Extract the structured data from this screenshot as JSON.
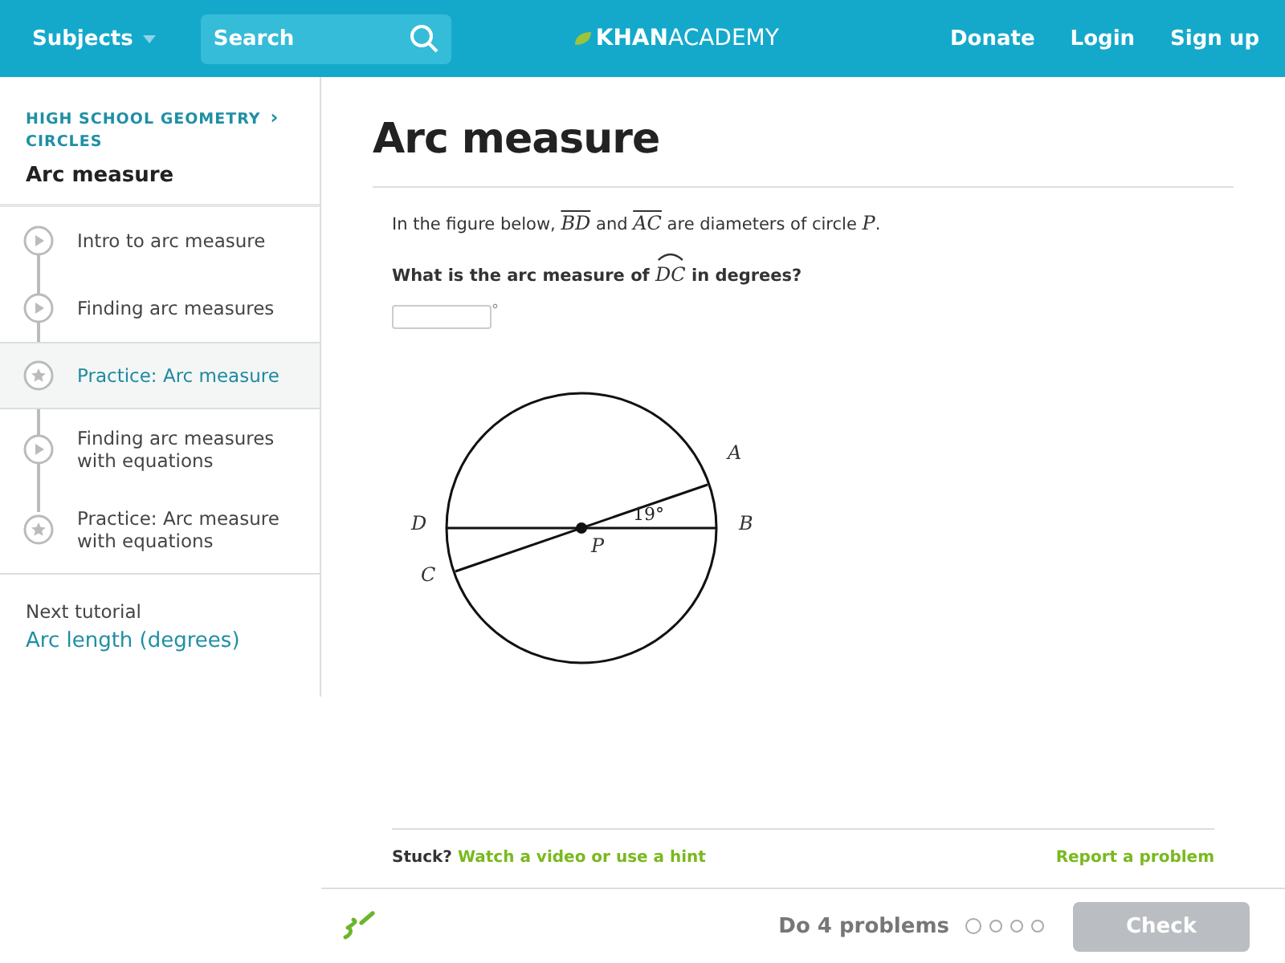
{
  "header": {
    "subjects": "Subjects",
    "search": {
      "placeholder": "Search"
    },
    "logo": {
      "bold": "KHAN",
      "light": "ACADEMY"
    },
    "links": [
      "Donate",
      "Login",
      "Sign up"
    ]
  },
  "sidebar": {
    "breadcrumb": [
      "HIGH SCHOOL GEOMETRY",
      "CIRCLES"
    ],
    "breadcrumb_separator": "›",
    "title": "Arc measure",
    "items": [
      {
        "label": "Intro to arc measure",
        "kind": "video",
        "selected": false
      },
      {
        "label": "Finding arc measures",
        "kind": "video",
        "selected": false
      },
      {
        "label": "Practice: Arc measure",
        "kind": "practice",
        "selected": true
      },
      {
        "label": "Finding arc measures with equations",
        "kind": "video",
        "selected": false
      },
      {
        "label": "Practice: Arc measure with equations",
        "kind": "practice",
        "selected": false
      }
    ],
    "next": {
      "label": "Next tutorial",
      "link": "Arc length (degrees)"
    }
  },
  "main": {
    "title": "Arc measure",
    "statement": [
      {
        "kind": "text",
        "text": "In the figure below, "
      },
      {
        "kind": "segment",
        "text": "BD"
      },
      {
        "kind": "text",
        "text": " and "
      },
      {
        "kind": "segment",
        "text": "AC"
      },
      {
        "kind": "text",
        "text": " are diameters of circle "
      },
      {
        "kind": "var",
        "text": "P"
      },
      {
        "kind": "text",
        "text": "."
      }
    ],
    "question": [
      {
        "kind": "text",
        "text": "What is the arc measure of "
      },
      {
        "kind": "arc",
        "text": "DC"
      },
      {
        "kind": "text",
        "text": " in degrees?"
      }
    ],
    "answer": {
      "unit": "°"
    },
    "figure": {
      "labels": [
        "A",
        "B",
        "C",
        "D",
        "P"
      ],
      "angle": "19°"
    },
    "stuck": {
      "label": "Stuck?",
      "link": "Watch a video or use a hint",
      "report": "Report a problem"
    }
  },
  "footer": {
    "goal": "Do 4 problems",
    "problems": [
      {
        "selected": true
      },
      {
        "selected": false
      },
      {
        "selected": false
      },
      {
        "selected": false
      }
    ],
    "check": "Check"
  }
}
